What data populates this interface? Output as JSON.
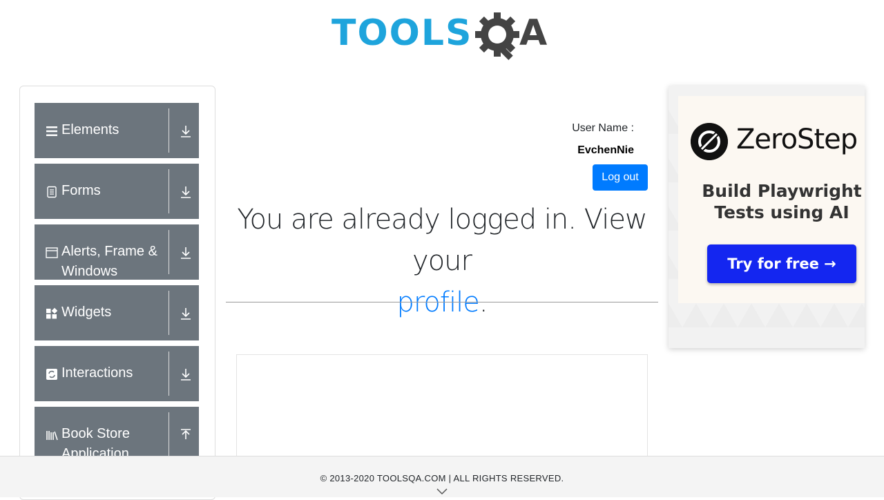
{
  "logo": {
    "part1": "TOOLS",
    "part2": "A",
    "brand_color": "#1ea4dc",
    "dark_color": "#444444"
  },
  "sidebar": {
    "groups": [
      {
        "label": "Elements",
        "icon": "hamburger-icon",
        "arrow": "download-arrow-icon"
      },
      {
        "label": "Forms",
        "icon": "form-icon",
        "arrow": "download-arrow-icon"
      },
      {
        "label": "Alerts, Frame & Windows",
        "icon": "window-icon",
        "arrow": "download-arrow-icon"
      },
      {
        "label": "Widgets",
        "icon": "widgets-icon",
        "arrow": "download-arrow-icon"
      },
      {
        "label": "Interactions",
        "icon": "interactions-icon",
        "arrow": "download-arrow-icon"
      },
      {
        "label": "Book Store Application",
        "icon": "books-icon",
        "arrow": "upload-arrow-icon"
      }
    ],
    "color": "#6c757d"
  },
  "main": {
    "user_label": "User Name :",
    "user_value": "EvchenNie",
    "logout_label": "Log out",
    "message_prefix": "You are already logged in. View your",
    "message_link": "profile",
    "message_suffix": ".",
    "accent": "#007bff"
  },
  "ad": {
    "brand": "ZeroStep",
    "tagline": "Build Playwright Tests using AI",
    "cta": "Try for free →",
    "cta_color": "#1426f0"
  },
  "footer": {
    "text": "© 2013-2020 TOOLSQA.COM | ALL RIGHTS RESERVED."
  }
}
